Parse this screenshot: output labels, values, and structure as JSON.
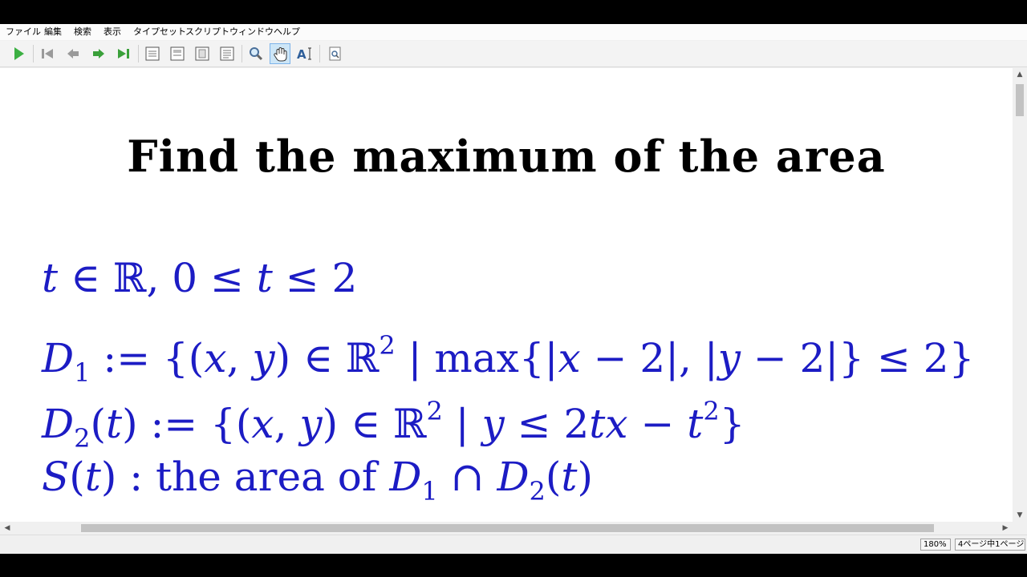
{
  "menu": [
    "ファイル",
    "編集",
    "検索",
    "表示",
    "タイプセット",
    "スクリプト",
    "ウィンドウ",
    "ヘルプ"
  ],
  "toolbar": {
    "icons": [
      "typeset-icon",
      "first-page-icon",
      "previous-page-icon",
      "next-page-icon",
      "last-page-icon",
      "view-single-icon",
      "view-continuous-icon",
      "view-facing-icon",
      "view-fit-icon",
      "magnify-icon",
      "hand-tool-icon",
      "text-select-icon",
      "search-icon"
    ],
    "active": "hand-tool-icon"
  },
  "document": {
    "title": "Find the maximum of the area",
    "lines": [
      "t ∈ ℝ, 0 ≤ t ≤ 2",
      "D1 := {(x, y) ∈ ℝ2 | max{|x − 2|, |y − 2|} ≤ 2}",
      "D2(t) := {(x, y) ∈ ℝ2 | y ≤ 2tx − t2}",
      "S(t) : the area of D1 ∩ D2(t)"
    ]
  },
  "status": {
    "zoom": "180%",
    "page": "4ページ中1ページ"
  },
  "colors": {
    "math": "#1c1cc4",
    "title": "#000000",
    "active_tool": "#cde6f7"
  }
}
